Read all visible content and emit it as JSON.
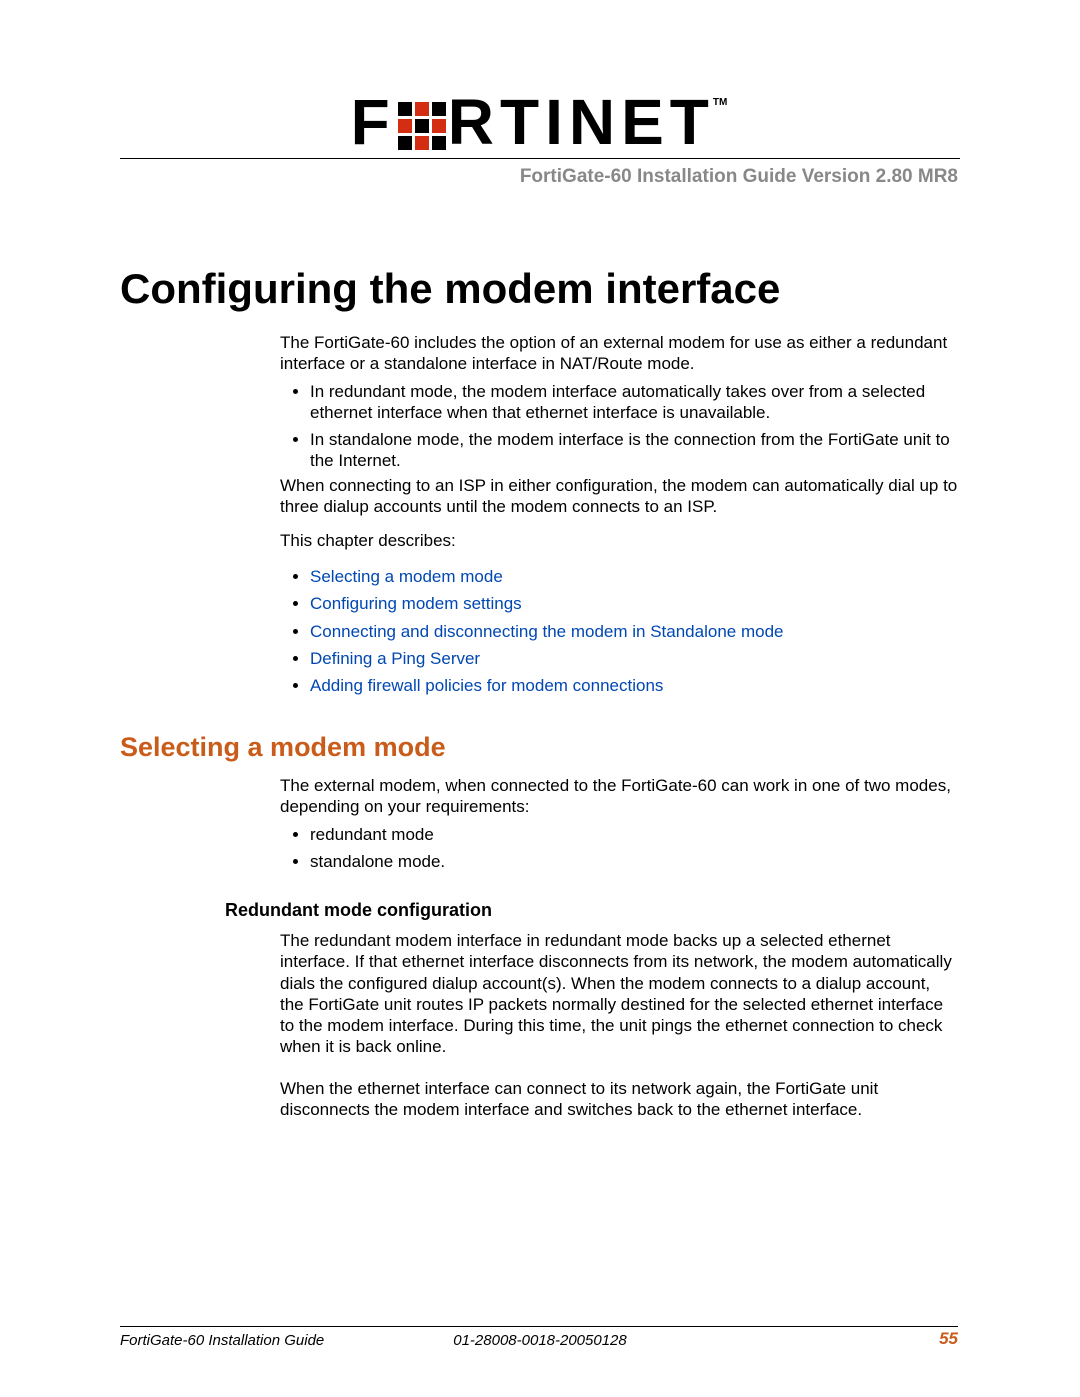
{
  "logo": {
    "text_left": "F",
    "text_right": "RTINET",
    "tm": "TM"
  },
  "subtitle": "FortiGate-60 Installation Guide Version 2.80 MR8",
  "chapter_title": "Configuring the modem interface",
  "intro_p1": "The FortiGate-60 includes the option of an external modem for use as either a redundant interface or a standalone interface in NAT/Route mode.",
  "intro_bullets": [
    "In redundant mode, the modem interface automatically takes over from a selected ethernet interface when that ethernet interface is unavailable.",
    "In standalone mode, the modem interface is the connection from the FortiGate unit to the Internet."
  ],
  "intro_p2": "When connecting to an ISP in either configuration, the modem can automatically dial up to three dialup accounts until the modem connects to an ISP.",
  "intro_p3": "This chapter describes:",
  "toc": [
    "Selecting a modem mode",
    "Configuring modem settings",
    "Connecting and disconnecting the modem in Standalone mode",
    "Defining a Ping Server",
    "Adding firewall policies for modem connections"
  ],
  "section1_title": "Selecting a modem mode",
  "section1_p1": "The external modem, when connected to the FortiGate-60 can work in one of two modes, depending on your requirements:",
  "section1_bullets": [
    "redundant mode",
    "standalone mode."
  ],
  "subsection1_title": "Redundant mode configuration",
  "subsection1_p1": "The redundant modem interface in redundant mode backs up a selected ethernet interface. If that ethernet interface disconnects from its network, the modem automatically dials the configured dialup account(s). When the modem connects to a dialup account, the FortiGate unit routes IP packets normally destined for the selected ethernet interface to the modem interface. During this time, the unit pings the ethernet connection to check when it is back online.",
  "subsection1_p2": "When the ethernet interface can connect to its network again, the FortiGate unit disconnects the modem interface and switches back to the ethernet interface.",
  "footer": {
    "left": "FortiGate-60 Installation Guide",
    "center": "01-28008-0018-20050128",
    "right": "55"
  }
}
